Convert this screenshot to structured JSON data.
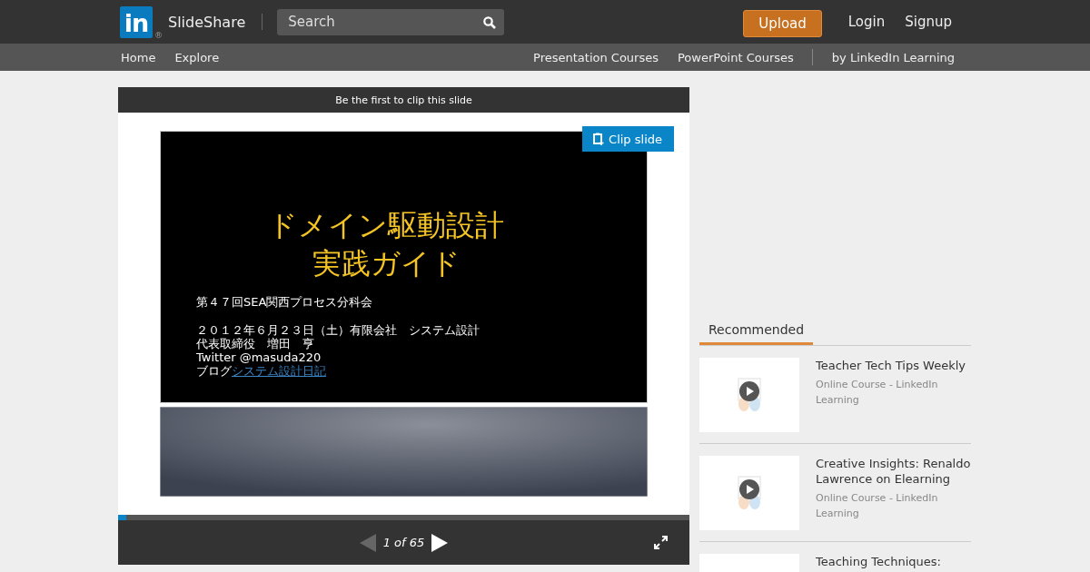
{
  "header": {
    "logo_mark": "in",
    "logo_registered": "®",
    "brand": "SlideShare",
    "search": {
      "placeholder": "Search"
    },
    "upload": "Upload",
    "links": [
      "Login",
      "Signup"
    ]
  },
  "subnav": {
    "left": [
      "Home",
      "Explore"
    ],
    "right": [
      "Presentation Courses",
      "PowerPoint Courses"
    ],
    "partner": "by LinkedIn Learning"
  },
  "player": {
    "clip_banner": "Be the first to clip this slide",
    "clip_button": "Clip slide",
    "slide": {
      "title_lines": [
        "ドメイン駆動設計",
        "実践ガイド"
      ],
      "event": "第４７回SEA関西プロセス分科会",
      "lines": [
        "２０１２年６月２３日（土）有限会社　システム設計",
        "代表取締役　増田　亨",
        "Twitter @masuda220"
      ],
      "blog_label": "ブログ",
      "blog_link": "システム設計日記"
    },
    "progress": {
      "level": 0.015
    },
    "prev": {
      "disabled": true
    },
    "next": {
      "disabled": false
    },
    "page": "1 of 65"
  },
  "recommended": {
    "tab": "Recommended",
    "items": [
      {
        "title": "Teacher Tech Tips Weekly",
        "subtitle": "Online Course - LinkedIn Learning"
      },
      {
        "title": "Creative Insights: Renaldo Lawrence on Elearning",
        "subtitle": "Online Course - LinkedIn Learning"
      },
      {
        "title": "Teaching Techniques:"
      }
    ]
  }
}
